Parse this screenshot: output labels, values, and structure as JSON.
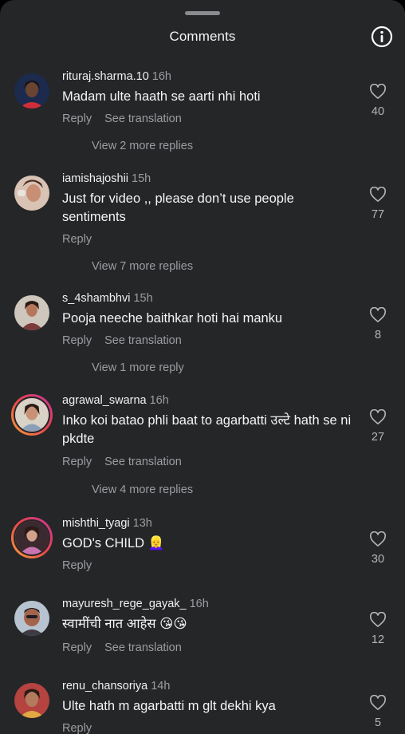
{
  "header": {
    "title": "Comments"
  },
  "comments": [
    {
      "username": "rituraj.sharma.10",
      "time": "16h",
      "text": "Madam ulte haath se aarti nhi hoti",
      "reply": "Reply",
      "translate": "See translation",
      "more_replies": "View 2 more replies",
      "likes": "40"
    },
    {
      "username": "iamishajoshii",
      "time": "15h",
      "text": "Just for video ,, please don’t use people sentiments",
      "reply": "Reply",
      "more_replies": "View 7 more replies",
      "likes": "77"
    },
    {
      "username": "s_4shambhvi",
      "time": "15h",
      "text": "Pooja neeche baithkar hoti hai manku",
      "reply": "Reply",
      "translate": "See translation",
      "more_replies": "View 1 more reply",
      "likes": "8"
    },
    {
      "username": "agrawal_swarna",
      "time": "16h",
      "text": "Inko koi batao phli baat to agarbatti उल्टे hath se ni pkdte",
      "reply": "Reply",
      "translate": "See translation",
      "more_replies": "View 4 more replies",
      "likes": "27"
    },
    {
      "username": "mishthi_tyagi",
      "time": "13h",
      "text": "GOD's CHILD 👱‍♀️",
      "reply": "Reply",
      "likes": "30"
    },
    {
      "username": "mayuresh_rege_gayak_",
      "time": "16h",
      "text": "स्वामींची नात आहेस 😘😘",
      "reply": "Reply",
      "translate": "See translation",
      "likes": "12"
    },
    {
      "username": "renu_chansoriya",
      "time": "14h",
      "text": "Ulte hath m agarbatti m glt dekhi kya",
      "reply": "Reply",
      "likes": "5"
    }
  ]
}
